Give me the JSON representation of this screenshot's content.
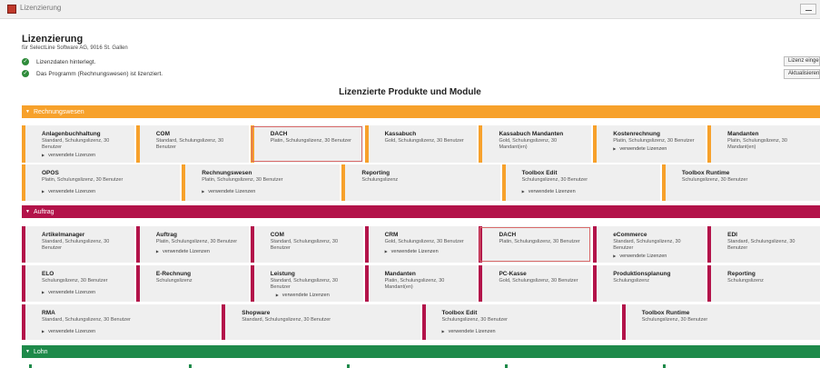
{
  "window": {
    "title": "Lizenzierung"
  },
  "header": {
    "title": "Lizenzierung",
    "subtitle": "für SelectLine Software AG, 9016 St. Gallen"
  },
  "status": [
    "Lizenzdaten hinterlegt.",
    "Das Programm (Rechnungswesen) ist lizenziert."
  ],
  "buttons": {
    "enter_license": "Lizenz eingeben",
    "refresh": "Aktualisieren"
  },
  "main_heading": "Lizenzierte Produkte und Module",
  "used_label": "verwendete Lizenzen",
  "colors": {
    "rechnungswesen": "#f7a12b",
    "auftrag": "#b3134a",
    "lohn": "#1e8a4a"
  },
  "sections": {
    "rechnungswesen": {
      "label": "Rechnungswesen",
      "row1": [
        {
          "name": "Anlagenbuchhaltung",
          "desc": "Standard, Schulungslizenz, 30 Benutzer"
        },
        {
          "name": "COM",
          "desc": "Standard, Schulungslizenz, 30 Benutzer"
        },
        {
          "name": "DACH",
          "desc": "Platin, Schulungslizenz, 30 Benutzer"
        },
        {
          "name": "Kassabuch",
          "desc": "Gold, Schulungslizenz, 30 Benutzer"
        },
        {
          "name": "Kassabuch Mandanten",
          "desc": "Gold, Schulungslizenz, 30 Mandant(en)"
        },
        {
          "name": "Kostenrechnung",
          "desc": "Platin, Schulungslizenz, 30 Benutzer"
        },
        {
          "name": "Mandanten",
          "desc": "Platin, Schulungslizenz, 30 Mandant(en)"
        }
      ],
      "row2": [
        {
          "name": "OPOS",
          "desc": "Platin, Schulungslizenz, 30 Benutzer"
        },
        {
          "name": "Rechnungswesen",
          "desc": "Platin, Schulungslizenz, 30 Benutzer"
        },
        {
          "name": "Reporting",
          "desc": "Schulungslizenz"
        },
        {
          "name": "Toolbox Edit",
          "desc": "Schulungslizenz, 30 Benutzer"
        },
        {
          "name": "Toolbox Runtime",
          "desc": "Schulungslizenz, 30 Benutzer"
        }
      ]
    },
    "auftrag": {
      "label": "Auftrag",
      "row1": [
        {
          "name": "Artikelmanager",
          "desc": "Standard, Schulungslizenz, 30 Benutzer"
        },
        {
          "name": "Auftrag",
          "desc": "Platin, Schulungslizenz, 30 Benutzer"
        },
        {
          "name": "COM",
          "desc": "Standard, Schulungslizenz, 30 Benutzer"
        },
        {
          "name": "CRM",
          "desc": "Gold, Schulungslizenz, 30 Benutzer"
        },
        {
          "name": "DACH",
          "desc": "Platin, Schulungslizenz, 30 Benutzer"
        },
        {
          "name": "eCommerce",
          "desc": "Standard, Schulungslizenz, 30 Benutzer"
        },
        {
          "name": "EDI",
          "desc": "Standard, Schulungslizenz, 30 Benutzer"
        }
      ],
      "row2": [
        {
          "name": "ELO",
          "desc": "Schulungslizenz, 30 Benutzer"
        },
        {
          "name": "E-Rechnung",
          "desc": "Schulungslizenz"
        },
        {
          "name": "Leistung",
          "desc": "Standard, Schulungslizenz, 30 Benutzer"
        },
        {
          "name": "Mandanten",
          "desc": "Platin, Schulungslizenz, 30 Mandant(en)"
        },
        {
          "name": "PC-Kasse",
          "desc": "Gold, Schulungslizenz, 30 Benutzer"
        },
        {
          "name": "Produktionsplanung",
          "desc": "Schulungslizenz"
        },
        {
          "name": "Reporting",
          "desc": "Schulungslizenz"
        }
      ],
      "row3": [
        {
          "name": "RMA",
          "desc": "Standard, Schulungslizenz, 30 Benutzer"
        },
        {
          "name": "Shopware",
          "desc": "Standard, Schulungslizenz, 30 Benutzer"
        },
        {
          "name": "Toolbox Edit",
          "desc": "Schulungslizenz, 30 Benutzer"
        },
        {
          "name": "Toolbox Runtime",
          "desc": "Schulungslizenz, 30 Benutzer"
        }
      ]
    },
    "lohn": {
      "label": "Lohn"
    }
  }
}
